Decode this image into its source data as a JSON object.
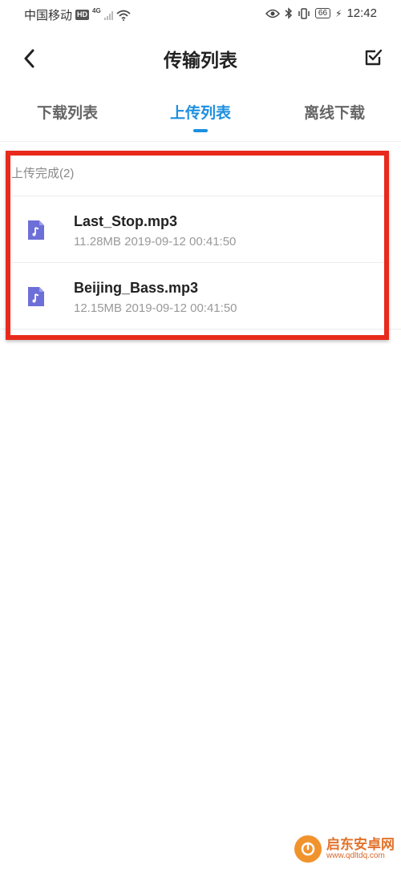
{
  "status_bar": {
    "carrier": "中国移动",
    "hd": "HD",
    "network": "4G",
    "battery": "66",
    "time": "12:42"
  },
  "header": {
    "title": "传输列表"
  },
  "tabs": [
    {
      "label": "下载列表",
      "active": false
    },
    {
      "label": "上传列表",
      "active": true
    },
    {
      "label": "离线下载",
      "active": false
    }
  ],
  "upload_section": {
    "header": "上传完成(2)",
    "files": [
      {
        "name": "Last_Stop.mp3",
        "size": "11.28MB",
        "date": "2019-09-12 00:41:50"
      },
      {
        "name": "Beijing_Bass.mp3",
        "size": "12.15MB",
        "date": "2019-09-12 00:41:50"
      }
    ]
  },
  "watermark": {
    "title": "启东安卓网",
    "url": "www.qdltdq.com"
  },
  "colors": {
    "accent": "#1c8fe0",
    "file_icon": "#6d6fd8",
    "highlight": "#e82a1c"
  }
}
